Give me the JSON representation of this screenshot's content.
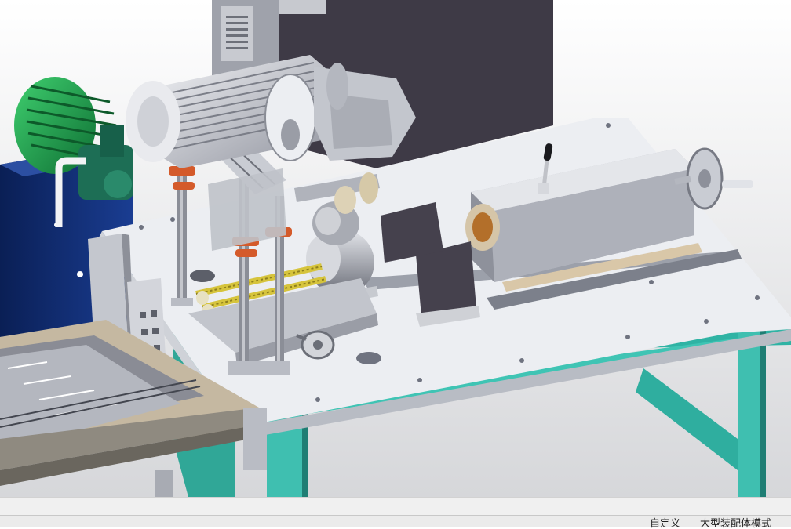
{
  "statusbar": {
    "units_label": "自定义",
    "document_label": "大型装配体模式"
  },
  "colors": {
    "background_top": "#ffffff",
    "background_bottom": "#d9dadd",
    "frame_cyan": "#3fbfb0",
    "tabletop": "#eceef2",
    "motor_green": "#1f9a4e",
    "tank_blue": "#0d2a6e",
    "cabinet_dark": "#3f3b47",
    "accent_orange": "#d45a2a",
    "rod_yellow": "#d6c43c"
  },
  "icons": [
    "electric-motor-icon",
    "hydraulic-pump-icon",
    "handwheel-icon",
    "clamp-lever-icon"
  ]
}
